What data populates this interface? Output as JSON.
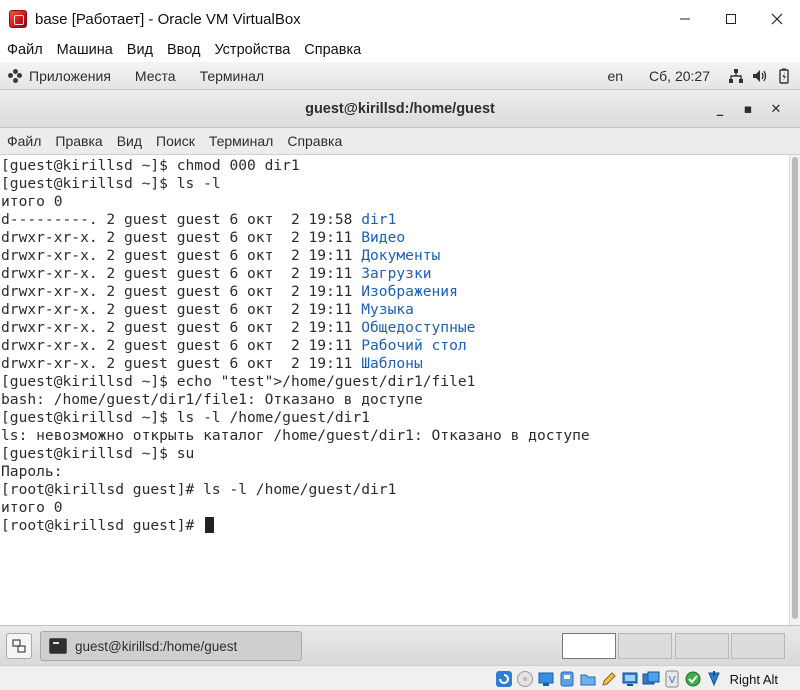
{
  "host_window": {
    "title": "base [Работает] - Oracle VM VirtualBox",
    "minimize": "–",
    "maximize": "☐",
    "close": "✕"
  },
  "vbox_menu": [
    "Файл",
    "Машина",
    "Вид",
    "Ввод",
    "Устройства",
    "Справка"
  ],
  "gnome_panel": {
    "applications": "Приложения",
    "places": "Места",
    "terminal": "Терминал",
    "language": "en",
    "clock": "Сб, 20:27"
  },
  "terminal_window": {
    "title": "guest@kirillsd:/home/guest",
    "minimize": "_",
    "maximize": "▪",
    "close": "✕",
    "menu": [
      "Файл",
      "Правка",
      "Вид",
      "Поиск",
      "Терминал",
      "Справка"
    ]
  },
  "terminal_lines": [
    {
      "text": "[guest@kirillsd ~]$ chmod 000 dir1"
    },
    {
      "text": "[guest@kirillsd ~]$ ls -l"
    },
    {
      "text": "итого 0"
    },
    {
      "text": "d---------. 2 guest guest 6 окт  2 19:58 ",
      "dir": "dir1"
    },
    {
      "text": "drwxr-xr-x. 2 guest guest 6 окт  2 19:11 ",
      "dir": "Видео"
    },
    {
      "text": "drwxr-xr-x. 2 guest guest 6 окт  2 19:11 ",
      "dir": "Документы"
    },
    {
      "text": "drwxr-xr-x. 2 guest guest 6 окт  2 19:11 ",
      "dir": "Загрузки"
    },
    {
      "text": "drwxr-xr-x. 2 guest guest 6 окт  2 19:11 ",
      "dir": "Изображения"
    },
    {
      "text": "drwxr-xr-x. 2 guest guest 6 окт  2 19:11 ",
      "dir": "Музыка"
    },
    {
      "text": "drwxr-xr-x. 2 guest guest 6 окт  2 19:11 ",
      "dir": "Общедоступные"
    },
    {
      "text": "drwxr-xr-x. 2 guest guest 6 окт  2 19:11 ",
      "dir": "Рабочий стол"
    },
    {
      "text": "drwxr-xr-x. 2 guest guest 6 окт  2 19:11 ",
      "dir": "Шаблоны"
    },
    {
      "text": "[guest@kirillsd ~]$ echo \"test\">/home/guest/dir1/file1"
    },
    {
      "text": "bash: /home/guest/dir1/file1: Отказано в доступе"
    },
    {
      "text": "[guest@kirillsd ~]$ ls -l /home/guest/dir1"
    },
    {
      "text": "ls: невозможно открыть каталог /home/guest/dir1: Отказано в доступе"
    },
    {
      "text": "[guest@kirillsd ~]$ su"
    },
    {
      "text": "Пароль:"
    },
    {
      "text": "[root@kirillsd guest]# ls -l /home/guest/dir1"
    },
    {
      "text": "итого 0"
    },
    {
      "text": "[root@kirillsd guest]# ",
      "cursor": true
    }
  ],
  "taskbar": {
    "window_button": "guest@kirillsd:/home/guest",
    "workspace_count": 4,
    "active_workspace": 1
  },
  "status_bar": {
    "host_key": "Right Alt",
    "icons": [
      "optical-drive-icon",
      "audio-icon",
      "network-icon",
      "usb-icon",
      "shared-folders-icon",
      "pencil-icon",
      "display-icon",
      "recording-icon",
      "virtualization-icon",
      "cpu-icon",
      "mouse-integration-icon"
    ]
  },
  "colors": {
    "directory": "#1c5fb8",
    "terminal_fg": "#2b2b2b"
  }
}
